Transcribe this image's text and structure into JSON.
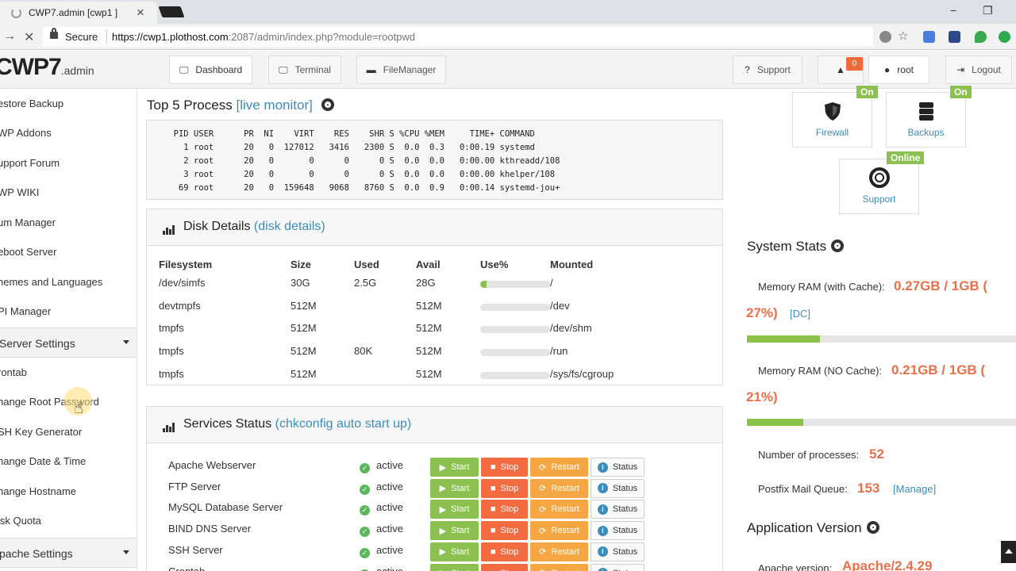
{
  "browser": {
    "tab_title": "CWP7.admin [cwp1 ]",
    "tab_close": "×",
    "secure_label": "Secure",
    "url_host": "https://cwp1.plothost.com",
    "url_rest": ":2087/admin/index.php?module=rootpwd",
    "window_controls": [
      "−",
      "❐",
      "✕"
    ]
  },
  "header": {
    "logo_main": "CWP7",
    "logo_sub": ".admin",
    "buttons": {
      "dashboard": "Dashboard",
      "terminal": "Terminal",
      "filemanager": "FileManager",
      "support": "Support",
      "user": "root",
      "logout": "Logout"
    },
    "notification_count": "0"
  },
  "sidebar": {
    "items_top": [
      "estore Backup",
      "WP Addons",
      "upport Forum",
      "WP WIKI",
      "um Manager",
      "eboot Server",
      "hemes and Languages",
      "PI Manager"
    ],
    "section_server": "Server Settings",
    "items_server": [
      "rontab",
      "hange Root Password",
      "SH Key Generator",
      "hange Date & Time",
      "hange Hostname",
      "isk Quota"
    ],
    "section_apache": "pache Settings"
  },
  "process": {
    "title": "Top 5 Process",
    "link": "[live monitor]",
    "output": "  PID USER      PR  NI    VIRT    RES    SHR S %CPU %MEM     TIME+ COMMAND\n    1 root      20   0  127012   3416   2300 S  0.0  0.3   0:00.19 systemd\n    2 root      20   0       0      0      0 S  0.0  0.0   0:00.00 kthreadd/108\n    3 root      20   0       0      0      0 S  0.0  0.0   0:00.00 khelper/108\n   69 root      20   0  159648   9068   8760 S  0.0  0.9   0:00.14 systemd-jou+"
  },
  "disk": {
    "title": "Disk Details",
    "link": "(disk details)",
    "headers": [
      "Filesystem",
      "Size",
      "Used",
      "Avail",
      "Use%",
      "Mounted"
    ],
    "rows": [
      {
        "fs": "/dev/simfs",
        "size": "30G",
        "used": "2.5G",
        "avail": "28G",
        "use": 0.09,
        "mount": "/"
      },
      {
        "fs": "devtmpfs",
        "size": "512M",
        "used": "",
        "avail": "512M",
        "use": 0,
        "mount": "/dev"
      },
      {
        "fs": "tmpfs",
        "size": "512M",
        "used": "",
        "avail": "512M",
        "use": 0,
        "mount": "/dev/shm"
      },
      {
        "fs": "tmpfs",
        "size": "512M",
        "used": "80K",
        "avail": "512M",
        "use": 0,
        "mount": "/run"
      },
      {
        "fs": "tmpfs",
        "size": "512M",
        "used": "",
        "avail": "512M",
        "use": 0,
        "mount": "/sys/fs/cgroup"
      }
    ]
  },
  "services": {
    "title": "Services Status",
    "link": "(chkconfig auto start up)",
    "button_labels": {
      "start": "Start",
      "stop": "Stop",
      "restart": "Restart",
      "status": "Status"
    },
    "rows": [
      {
        "name": "Apache Webserver",
        "status": "active"
      },
      {
        "name": "FTP Server",
        "status": "active"
      },
      {
        "name": "MySQL Database Server",
        "status": "active"
      },
      {
        "name": "BIND DNS Server",
        "status": "active"
      },
      {
        "name": "SSH Server",
        "status": "active"
      },
      {
        "name": "Crontab",
        "status": "active"
      }
    ]
  },
  "tiles": {
    "firewall": {
      "label": "Firewall",
      "badge": "On"
    },
    "backups": {
      "label": "Backups",
      "badge": "On"
    },
    "support": {
      "label": "Support",
      "badge": "Online"
    }
  },
  "system_stats": {
    "title": "System Stats",
    "mem_cache_label": "Memory RAM (with Cache):",
    "mem_cache_value": "0.27GB / 1GB (",
    "mem_cache_pct": "27%)",
    "mem_cache_link": "[DC]",
    "mem_cache_fraction": 0.27,
    "mem_nocache_label": "Memory RAM (NO Cache):",
    "mem_nocache_value": "0.21GB / 1GB (",
    "mem_nocache_pct": "21%)",
    "mem_nocache_fraction": 0.21,
    "processes_label": "Number of processes:",
    "processes_value": "52",
    "mail_label": "Postfix Mail Queue:",
    "mail_value": "153",
    "mail_link": "[Manage]"
  },
  "app_version": {
    "title": "Application Version",
    "apache_label": "Apache version:",
    "apache_value": "Apache/2.4.29"
  },
  "colors": {
    "accent": "#3c8dbc",
    "start": "#8cc152",
    "stop": "#f26b41",
    "restart": "#f6a744",
    "value": "#e8704a"
  }
}
